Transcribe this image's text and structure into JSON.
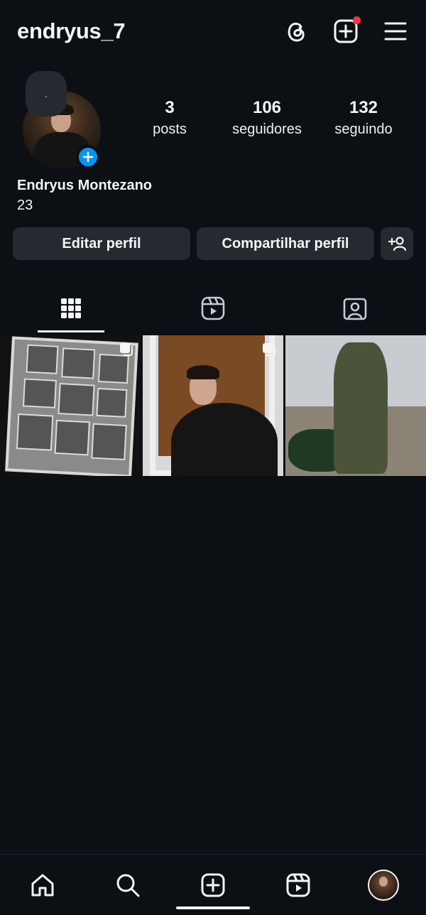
{
  "header": {
    "username": "endryus_7",
    "icons": [
      "threads-icon",
      "create-post-icon",
      "menu-icon"
    ],
    "notification_dot_color": "#ff3040"
  },
  "profile": {
    "note_text": ".",
    "add_story_color": "#0095f6",
    "stats": [
      {
        "value": "3",
        "label": "posts"
      },
      {
        "value": "106",
        "label": "seguidores"
      },
      {
        "value": "132",
        "label": "seguindo"
      }
    ],
    "full_name": "Endryus Montezano",
    "bio": "23"
  },
  "actions": {
    "edit_label": "Editar perfil",
    "share_label": "Compartilhar perfil",
    "suggest_icon": "add-person-icon"
  },
  "tabs": [
    {
      "name": "posts-grid",
      "icon": "grid-icon",
      "active": true
    },
    {
      "name": "reels",
      "icon": "reels-icon",
      "active": false
    },
    {
      "name": "tagged",
      "icon": "tagged-icon",
      "active": false
    }
  ],
  "posts": [
    {
      "type": "carousel"
    },
    {
      "type": "carousel"
    },
    {
      "type": "single"
    }
  ],
  "bottom_nav": [
    {
      "name": "home",
      "icon": "home-icon"
    },
    {
      "name": "search",
      "icon": "search-icon"
    },
    {
      "name": "create",
      "icon": "create-icon"
    },
    {
      "name": "reels",
      "icon": "reels-icon"
    },
    {
      "name": "profile",
      "icon": "profile-avatar"
    }
  ],
  "colors": {
    "background": "#0c0f14",
    "button": "#262a30",
    "text": "#f5f5f5"
  }
}
